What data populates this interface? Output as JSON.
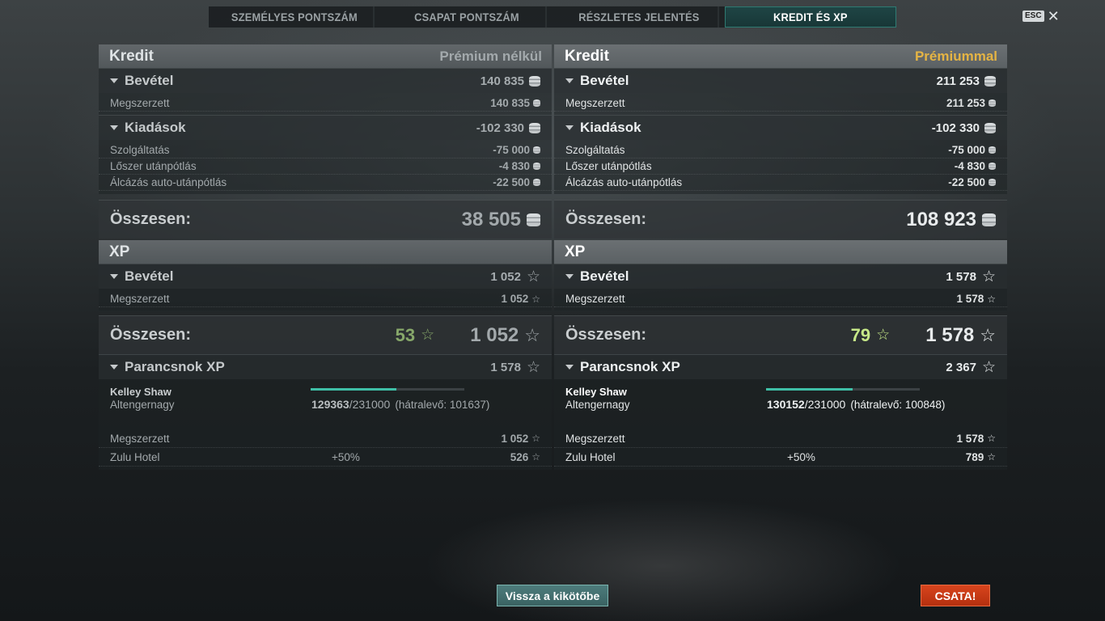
{
  "tabs": [
    {
      "label": "SZEMÉLYES PONTSZÁM"
    },
    {
      "label": "CSAPAT PONTSZÁM"
    },
    {
      "label": "RÉSZLETES JELENTÉS"
    },
    {
      "label": "KREDIT ÉS XP"
    }
  ],
  "esc": {
    "label": "ESC",
    "close": "✕"
  },
  "colors": {
    "accent": "#2f7a72",
    "premium": "#e5b444",
    "battle": "#d8441d",
    "green_xp": "#87a86a"
  },
  "left": {
    "credit_title": "Kredit",
    "credit_subtitle": "Prémium nélkül",
    "income_label": "Bevétel",
    "income_value": "140 835",
    "earned_label": "Megszerzett",
    "earned_value": "140 835",
    "expenses_label": "Kiadások",
    "expenses_value": "-102 330",
    "service_label": "Szolgáltatás",
    "service_value": "-75 000",
    "ammo_label": "Lőszer utánpótlás",
    "ammo_value": "-4 830",
    "camo_label": "Álcázás auto-utánpótlás",
    "camo_value": "-22 500",
    "total_label": "Összesen:",
    "total_value": "38 505",
    "xp_title": "XP",
    "xp_income_label": "Bevétel",
    "xp_income_value": "1 052",
    "xp_earned_label": "Megszerzett",
    "xp_earned_value": "1 052",
    "xp_total_label": "Összesen:",
    "xp_total_free": "53",
    "xp_total_value": "1 052",
    "cmd_label": "Parancsnok XP",
    "cmd_value": "1 578",
    "cmd_name": "Kelley Shaw",
    "cmd_rank": "Altengernagy",
    "cmd_xp_current": "129363",
    "cmd_xp_max": "/231000",
    "cmd_xp_remaining": "(hátralevő: 101637)",
    "cmd_progress": 0.56,
    "cmd_earned_label": "Megszerzett",
    "cmd_earned_value": "1 052",
    "bonus_label": "Zulu Hotel",
    "bonus_pct": "+50%",
    "bonus_value": "526"
  },
  "right": {
    "credit_title": "Kredit",
    "credit_subtitle": "Prémiummal",
    "income_label": "Bevétel",
    "income_value": "211 253",
    "earned_label": "Megszerzett",
    "earned_value": "211 253",
    "expenses_label": "Kiadások",
    "expenses_value": "-102 330",
    "service_label": "Szolgáltatás",
    "service_value": "-75 000",
    "ammo_label": "Lőszer utánpótlás",
    "ammo_value": "-4 830",
    "camo_label": "Álcázás auto-utánpótlás",
    "camo_value": "-22 500",
    "total_label": "Összesen:",
    "total_value": "108 923",
    "xp_title": "XP",
    "xp_income_label": "Bevétel",
    "xp_income_value": "1 578",
    "xp_earned_label": "Megszerzett",
    "xp_earned_value": "1 578",
    "xp_total_label": "Összesen:",
    "xp_total_free": "79",
    "xp_total_value": "1 578",
    "cmd_label": "Parancsnok XP",
    "cmd_value": "2 367",
    "cmd_name": "Kelley Shaw",
    "cmd_rank": "Altengernagy",
    "cmd_xp_current": "130152",
    "cmd_xp_max": "/231000",
    "cmd_xp_remaining": "(hátralevő: 100848)",
    "cmd_progress": 0.563,
    "cmd_earned_label": "Megszerzett",
    "cmd_earned_value": "1 578",
    "bonus_label": "Zulu Hotel",
    "bonus_pct": "+50%",
    "bonus_value": "789"
  },
  "buttons": {
    "back": "Vissza a kikötőbe",
    "battle": "CSATA!"
  }
}
